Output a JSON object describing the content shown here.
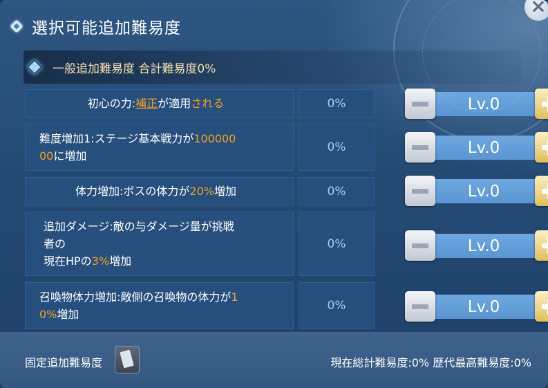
{
  "header": {
    "title": "選択可能追加難易度",
    "close_label": "×"
  },
  "subheader": {
    "text": "一般追加難易度 合計難易度0%"
  },
  "rows": [
    {
      "desc": [
        "初心の力:",
        "補正",
        "が適用",
        "される"
      ],
      "percent": "0%",
      "level": "Lv.0"
    },
    {
      "desc": [
        "難度増加1:ステージ基本戦力が",
        "100000",
        "00",
        "に増加"
      ],
      "percent": "0%",
      "level": "Lv.0"
    },
    {
      "desc": [
        "体力増加:ボスの体力が",
        "20%",
        "増加"
      ],
      "percent": "0%",
      "level": "Lv.0"
    },
    {
      "desc": [
        "追加ダメージ:敵の与ダメージ量が挑戦",
        "者の",
        "現在HPの",
        "3%",
        "増加"
      ],
      "percent": "0%",
      "level": "Lv.0"
    },
    {
      "desc": [
        "召喚物体力増加:敵側の召喚物の体力が",
        "1",
        "0%",
        "増加"
      ],
      "percent": "0%",
      "level": "Lv.0"
    }
  ],
  "footer": {
    "label": "固定追加難易度",
    "current_total": "現在総計難易度:0%",
    "best": "歴代最高難易度:0%"
  },
  "colors": {
    "highlight": "#f0a020",
    "panel": "#264f7d",
    "level_bar": "#5f9bd6"
  },
  "icons": [
    "diamond-icon",
    "close-icon",
    "minus-icon",
    "plus-icon",
    "card-icon"
  ]
}
